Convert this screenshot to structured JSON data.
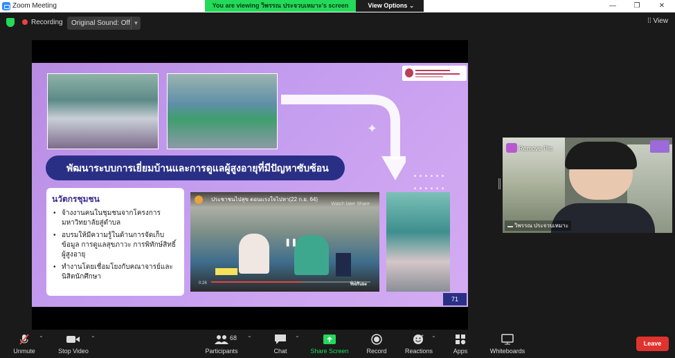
{
  "window": {
    "title": "Zoom Meeting",
    "controls": [
      "—",
      "❐",
      "✕"
    ]
  },
  "viewing_banner": {
    "text": "You are viewing วิพรรณ ประจวบเหมาะ's screen",
    "view_options": "View Options ⌄"
  },
  "status_bar": {
    "recording": "Recording",
    "original_sound": "Original Sound: Off",
    "view": "View"
  },
  "slide": {
    "banner_title": "พัฒนาระบบการเยี่ยมบ้านและการดูแลผู้สูงอายุที่มีปัญหาซับซ้อน",
    "card_title": "นวัตกรชุมชน",
    "card_items": [
      "จ้างงานคนในชุมชนจากโครงการมหาวิทยาลัยสู่ตำบล",
      "อบรมให้มีความรู้ในด้านการจัดเก็บข้อมูล การดูแลสุขภาวะ การพิทักษ์สิทธิ์ผู้สูงอายุ",
      "ทำงานโดยเชื่อมโยงกับคณาจารย์และนิสิตนักศึกษา"
    ],
    "video_title": "ประชาชนไปสุข ตอนแรงใจไปหา(22 ก.ย. 64)",
    "video_watch_later": "Watch later  Share",
    "video_time_left": "0:26",
    "video_time_right": "0:14",
    "video_brand": "YouTube",
    "page_number": "71"
  },
  "participant": {
    "remove_pin": "Remove Pin",
    "name": "วิพรรณ ประจวบเหมาะ"
  },
  "toolbar": {
    "unmute": "Unmute",
    "stop_video": "Stop Video",
    "participants": "Participants",
    "participants_count": "68",
    "chat": "Chat",
    "share_screen": "Share Screen",
    "record": "Record",
    "reactions": "Reactions",
    "apps": "Apps",
    "whiteboards": "Whiteboards",
    "leave": "Leave"
  },
  "colors": {
    "share_green": "#23d959",
    "leave_red": "#e0332d",
    "slide_banner": "#2a2f86",
    "slide_purple": "#c49cef"
  }
}
